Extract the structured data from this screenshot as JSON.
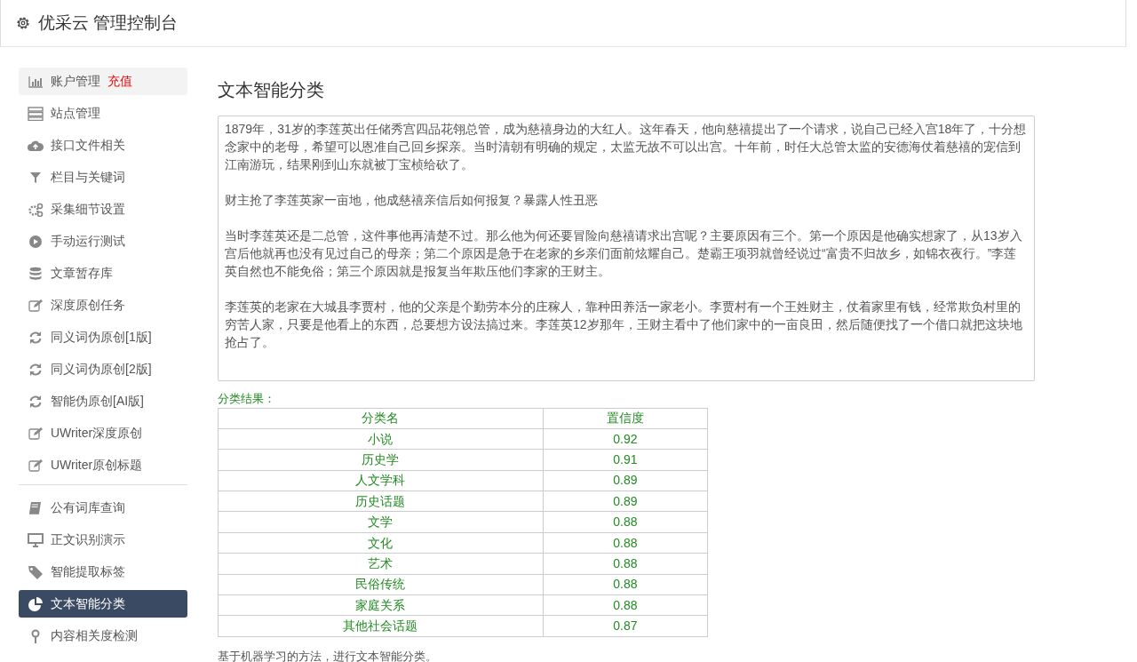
{
  "header": {
    "title": "优采云 管理控制台"
  },
  "sidebar": {
    "groups": [
      {
        "items": [
          {
            "label": "账户管理",
            "badge": "充值",
            "hovered": true,
            "selected": false
          },
          {
            "label": "站点管理",
            "hovered": false,
            "selected": false
          },
          {
            "label": "接口文件相关",
            "hovered": false,
            "selected": false
          },
          {
            "label": "栏目与关键词",
            "hovered": false,
            "selected": false
          },
          {
            "label": "采集细节设置",
            "hovered": false,
            "selected": false
          },
          {
            "label": "手动运行测试",
            "hovered": false,
            "selected": false
          },
          {
            "label": "文章暂存库",
            "hovered": false,
            "selected": false
          },
          {
            "label": "深度原创任务",
            "hovered": false,
            "selected": false
          },
          {
            "label": "同义词伪原创[1版]",
            "hovered": false,
            "selected": false
          },
          {
            "label": "同义词伪原创[2版]",
            "hovered": false,
            "selected": false
          },
          {
            "label": "智能伪原创[AI版]",
            "hovered": false,
            "selected": false
          },
          {
            "label": "UWriter深度原创",
            "hovered": false,
            "selected": false
          },
          {
            "label": "UWriter原创标题",
            "hovered": false,
            "selected": false
          }
        ]
      },
      {
        "items": [
          {
            "label": "公有词库查询",
            "hovered": false,
            "selected": false
          },
          {
            "label": "正文识别演示",
            "hovered": false,
            "selected": false
          },
          {
            "label": "智能提取标签",
            "hovered": false,
            "selected": false
          },
          {
            "label": "文本智能分类",
            "hovered": false,
            "selected": true
          },
          {
            "label": "内容相关度检测",
            "hovered": false,
            "selected": false
          }
        ]
      }
    ]
  },
  "main": {
    "title": "文本智能分类",
    "input_paragraphs": [
      "1879年，31岁的李莲英出任储秀宫四品花翎总管，成为慈禧身边的大红人。这年春天，他向慈禧提出了一个请求，说自己已经入宫18年了，十分想念家中的老母，希望可以恩准自己回乡探亲。当时清朝有明确的规定，太监无故不可以出宫。十年前，时任大总管太监的安德海仗着慈禧的宠信到江南游玩，结果刚到山东就被丁宝桢给砍了。",
      "财主抢了李莲英家一亩地，他成慈禧亲信后如何报复？暴露人性丑恶",
      "当时李莲英还是二总管，这件事他再清楚不过。那么他为何还要冒险向慈禧请求出宫呢？主要原因有三个。第一个原因是他确实想家了，从13岁入宫后他就再也没有见过自己的母亲；第二个原因是急于在老家的乡亲们面前炫耀自己。楚霸王项羽就曾经说过“富贵不归故乡，如锦衣夜行。”李莲英自然也不能免俗；第三个原因就是报复当年欺压他们李家的王财主。",
      "李莲英的老家在大城县李贾村，他的父亲是个勤劳本分的庄稼人，靠种田养活一家老小。李贾村有一个王姓财主，仗着家里有钱，经常欺负村里的穷苦人家，只要是他看上的东西，总要想方设法搞过来。李莲英12岁那年，王财主看中了他们家中的一亩良田，然后随便找了一个借口就把这块地抢占了。"
    ],
    "result_label": "分类结果：",
    "table": {
      "columns": [
        "分类名",
        "置信度"
      ],
      "rows": [
        [
          "小说",
          "0.92"
        ],
        [
          "历史学",
          "0.91"
        ],
        [
          "人文学科",
          "0.89"
        ],
        [
          "历史话题",
          "0.89"
        ],
        [
          "文学",
          "0.88"
        ],
        [
          "文化",
          "0.88"
        ],
        [
          "艺术",
          "0.88"
        ],
        [
          "民俗传统",
          "0.88"
        ],
        [
          "家庭关系",
          "0.88"
        ],
        [
          "其他社会话题",
          "0.87"
        ]
      ]
    },
    "note": "基于机器学习的方法，进行文本智能分类。"
  }
}
